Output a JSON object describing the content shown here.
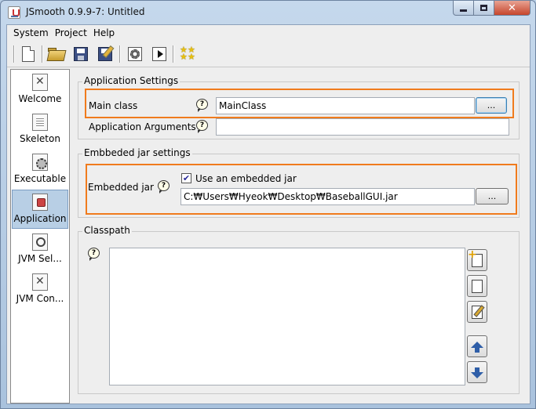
{
  "window": {
    "title": "JSmooth 0.9.9-7: Untitled",
    "close_glyph": "✕"
  },
  "menu": [
    "System",
    "Project",
    "Help"
  ],
  "toolbar": {
    "icons": [
      "new-file-icon",
      "open-folder-icon",
      "save-icon",
      "save-as-icon",
      "compile-gear-icon",
      "run-icon",
      "about-stars-icon"
    ]
  },
  "nav": {
    "items": [
      {
        "label": "Welcome",
        "icon": "welcome-icon"
      },
      {
        "label": "Skeleton",
        "icon": "skeleton-icon"
      },
      {
        "label": "Executable",
        "icon": "executable-icon"
      },
      {
        "label": "Application",
        "icon": "application-icon",
        "selected": true
      },
      {
        "label": "JVM Sel...",
        "icon": "jvm-selection-icon"
      },
      {
        "label": "JVM Con...",
        "icon": "jvm-configuration-icon"
      }
    ]
  },
  "application_settings": {
    "title": "Application Settings",
    "main_class_label": "Main class",
    "main_class_value": "MainClass",
    "browse_label": "...",
    "arguments_label": "Application Arguments",
    "arguments_value": ""
  },
  "embedded_jar": {
    "title": "Embbeded jar settings",
    "label": "Embedded jar",
    "checkbox_label": "Use an embedded jar",
    "checked": true,
    "path": "C:₩Users₩Hyeok₩Desktop₩BaseballGUI.jar",
    "browse_label": "..."
  },
  "classpath": {
    "title": "Classpath",
    "entries": []
  },
  "help_glyph": "?",
  "check_glyph": "✔",
  "colors": {
    "highlight": "#f07b1d",
    "selected_nav": "#b8cfe5",
    "window_frame": "#b9cfe6"
  }
}
